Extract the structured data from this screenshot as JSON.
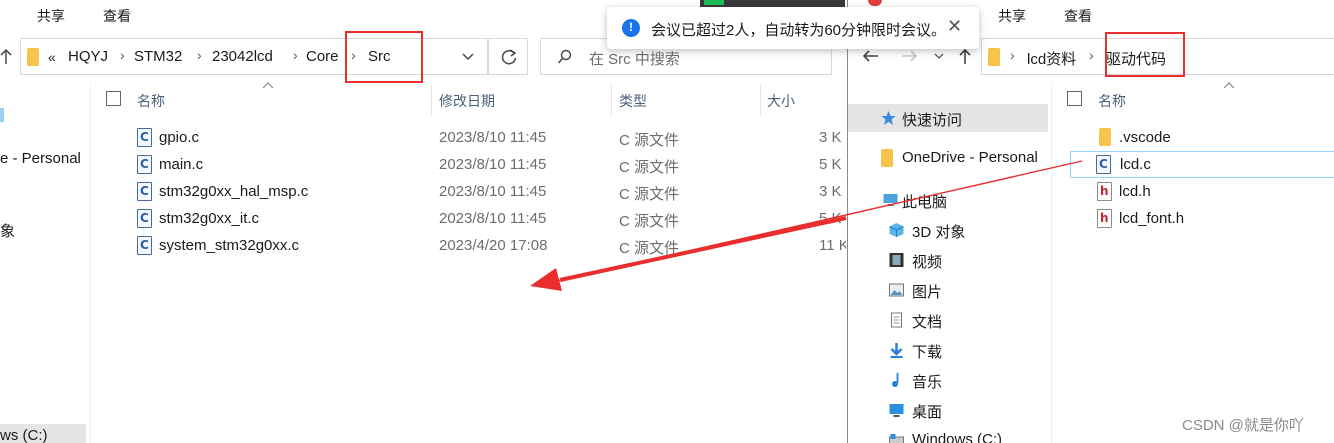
{
  "left_window": {
    "ribbon_tabs": [
      "共享",
      "查看"
    ],
    "breadcrumb": {
      "overflow": "«",
      "items": [
        "HQYJ",
        "STM32",
        "23042lcd",
        "Core",
        "Src"
      ]
    },
    "search_placeholder": "在 Src 中搜索",
    "nav_partial": {
      "item_1": "e - Personal",
      "item_2": "象",
      "item_3": "ws (C:)"
    },
    "columns": {
      "name": "名称",
      "date": "修改日期",
      "type": "类型",
      "size": "大小"
    },
    "files": [
      {
        "name": "gpio.c",
        "date": "2023/8/10 11:45",
        "type": "C 源文件",
        "size": "3 K"
      },
      {
        "name": "main.c",
        "date": "2023/8/10 11:45",
        "type": "C 源文件",
        "size": "5 K"
      },
      {
        "name": "stm32g0xx_hal_msp.c",
        "date": "2023/8/10 11:45",
        "type": "C 源文件",
        "size": "3 K"
      },
      {
        "name": "stm32g0xx_it.c",
        "date": "2023/8/10 11:45",
        "type": "C 源文件",
        "size": "5 K"
      },
      {
        "name": "system_stm32g0xx.c",
        "date": "2023/4/20 17:08",
        "type": "C 源文件",
        "size": "11 K"
      }
    ]
  },
  "right_window": {
    "ribbon_tabs": [
      "共享",
      "查看"
    ],
    "breadcrumb": {
      "items": [
        "lcd资料",
        "驱动代码"
      ]
    },
    "columns": {
      "name": "名称"
    },
    "nav": [
      {
        "label": "快速访问",
        "icon": "star-icon"
      },
      {
        "label": "OneDrive - Personal",
        "icon": "folder-icon"
      },
      {
        "label": "此电脑",
        "icon": "computer-icon"
      },
      {
        "label": "3D 对象",
        "icon": "cube-icon"
      },
      {
        "label": "视频",
        "icon": "video-icon"
      },
      {
        "label": "图片",
        "icon": "picture-icon"
      },
      {
        "label": "文档",
        "icon": "document-icon"
      },
      {
        "label": "下载",
        "icon": "download-icon"
      },
      {
        "label": "音乐",
        "icon": "music-icon"
      },
      {
        "label": "桌面",
        "icon": "desktop-icon"
      },
      {
        "label": "Windows (C:)",
        "icon": "drive-icon"
      }
    ],
    "files": [
      {
        "name": ".vscode",
        "icon": "folder-icon"
      },
      {
        "name": "lcd.c",
        "icon": "c-file-icon"
      },
      {
        "name": "lcd.h",
        "icon": "h-file-icon"
      },
      {
        "name": "lcd_font.h",
        "icon": "h-file-icon"
      }
    ]
  },
  "notification": {
    "message": "会议已超过2人，自动转为60分钟限时会议。",
    "info_glyph": "!",
    "close_glyph": "✕"
  },
  "watermark": "CSDN @就是你吖",
  "colors": {
    "highlight_red": "#ea2d2d",
    "selection_bg": "#e5e5e5",
    "folder_yellow": "#f6c34b",
    "info_blue": "#1a73e8"
  }
}
